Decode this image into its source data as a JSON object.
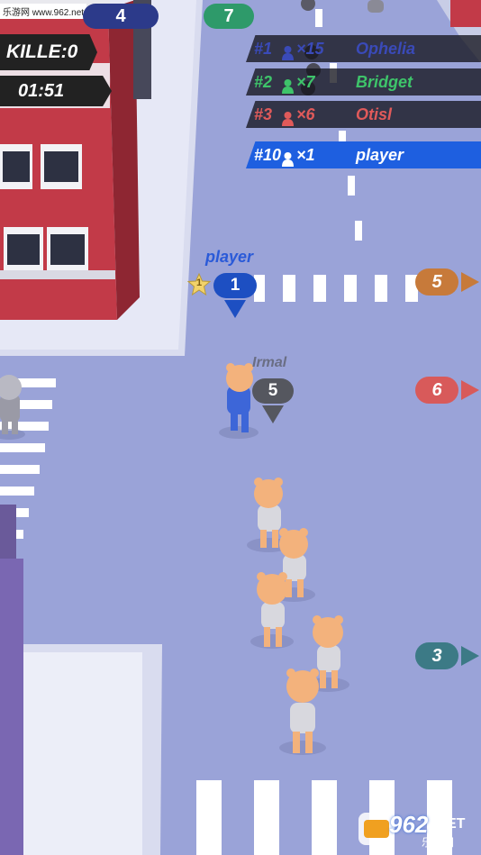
{
  "watermark": "乐游网 www.962.net",
  "hud": {
    "kills": "KILLE:0",
    "timer": "01:51"
  },
  "top_chips": [
    {
      "value": "4",
      "color": "#2c3a8a"
    },
    {
      "value": "7",
      "color": "#2e9a6a"
    }
  ],
  "leaderboard": [
    {
      "rank": "#1",
      "count": "×15",
      "name": "Ophelia",
      "color": "#3a4ab8",
      "bg": "rgba(20,20,30,0.78)"
    },
    {
      "rank": "#2",
      "count": "×7",
      "name": "Bridget",
      "color": "#3ec46a",
      "bg": "rgba(20,20,30,0.78)"
    },
    {
      "rank": "#3",
      "count": "×6",
      "name": "Otisl",
      "color": "#e05a5a",
      "bg": "rgba(20,20,30,0.78)"
    },
    {
      "rank": "#10",
      "count": "×1",
      "name": "player",
      "color": "#ffffff",
      "bg": "#1e5fe0"
    }
  ],
  "player_tag": {
    "name": "player",
    "count": "1",
    "star": "1"
  },
  "enemy_tag": {
    "name": "Irmal",
    "count": "5"
  },
  "offscreen": [
    {
      "value": "5",
      "color": "#c77a3a"
    },
    {
      "value": "6",
      "color": "#d85a5a"
    },
    {
      "value": "3",
      "color": "#3c7a86"
    }
  ],
  "logo": {
    "main": "962",
    "suffix": ".NET",
    "cn": "乐游网"
  }
}
